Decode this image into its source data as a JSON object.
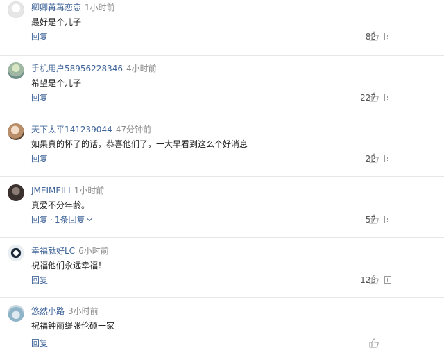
{
  "comments": [
    {
      "user": "卿卿苒苒恋恋",
      "time": "1小时前",
      "text": "最好是个儿子",
      "reply_label": "回复",
      "likes": "82",
      "avatar": "avatar-a0"
    },
    {
      "user": "手机用户58956228346",
      "time": "4小时前",
      "text": "希望是个儿子",
      "reply_label": "回复",
      "likes": "227",
      "avatar": "avatar-a1"
    },
    {
      "user": "天下太平141239044",
      "time": "47分钟前",
      "text": "如果真的怀了的话，恭喜他们了，一大早看到这么个好消息",
      "reply_label": "回复",
      "likes": "22",
      "avatar": "avatar-a2"
    },
    {
      "user": "JMEIMEILI",
      "time": "1小时前",
      "text": "真爱不分年龄。",
      "reply_label": "回复",
      "sub_replies": "1条回复",
      "likes": "57",
      "avatar": "avatar-a3"
    },
    {
      "user": "幸福就好LC",
      "time": "6小时前",
      "text": "祝福他们永远幸福！",
      "reply_label": "回复",
      "likes": "123",
      "avatar": "avatar-a4"
    },
    {
      "user": "悠然小路",
      "time": "3小时前",
      "text": "祝福钟丽缇张伦硕一家",
      "reply_label": "回复",
      "likes": "",
      "avatar": "avatar-a5"
    }
  ],
  "icons": {
    "like": "thumbs-up-icon",
    "report": "report-icon",
    "expand": "chevron-down-icon"
  }
}
